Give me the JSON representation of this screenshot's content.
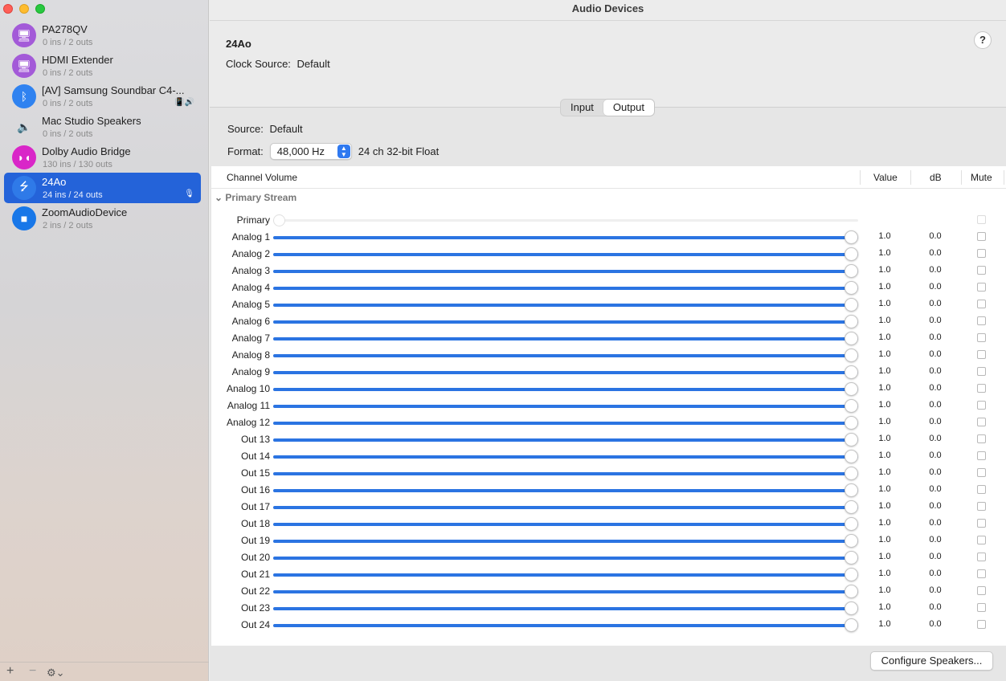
{
  "window": {
    "title": "Audio Devices"
  },
  "sidebar": {
    "devices": [
      {
        "name": "PA278QV",
        "io": "0 ins / 2 outs",
        "icon": "display-icon",
        "icon_color": "#a35ad8",
        "selected": false,
        "extra": ""
      },
      {
        "name": "HDMI Extender",
        "io": "0 ins / 2 outs",
        "icon": "display-icon",
        "icon_color": "#a35ad8",
        "selected": false,
        "extra": ""
      },
      {
        "name": "[AV] Samsung Soundbar C4-...",
        "io": "0 ins / 2 outs",
        "icon": "bluetooth-icon",
        "icon_color": "#2f82f0",
        "selected": false,
        "extra": "📳🔊"
      },
      {
        "name": "Mac Studio Speakers",
        "io": "0 ins / 2 outs",
        "icon": "speaker-icon",
        "icon_color": "#9a9a9a",
        "selected": false,
        "extra": ""
      },
      {
        "name": "Dolby Audio Bridge",
        "io": "130 ins / 130 outs",
        "icon": "dolby-icon",
        "icon_color": "#d926c8",
        "selected": false,
        "extra": ""
      },
      {
        "name": "24Ao",
        "io": "24 ins / 24 outs",
        "icon": "usb-icon",
        "icon_color": "#2f7ae8",
        "selected": true,
        "extra": "🎙"
      },
      {
        "name": "ZoomAudioDevice",
        "io": "2 ins / 2 outs",
        "icon": "video-camera-icon",
        "icon_color": "#1877e8",
        "selected": false,
        "extra": ""
      }
    ],
    "bottom": {
      "add": "+",
      "remove": "−",
      "gear": "⚙︎⌄"
    }
  },
  "header": {
    "device_title": "24Ao",
    "clock_label": "Clock Source:",
    "clock_value": "Default",
    "help": "?"
  },
  "tabs": {
    "input": "Input",
    "output": "Output",
    "active": "Output"
  },
  "settings": {
    "source_label": "Source:",
    "source_value": "Default",
    "format_label": "Format:",
    "format_value": "48,000 Hz",
    "format_detail": "24 ch 32-bit Float"
  },
  "table": {
    "columns": {
      "channel": "Channel Volume",
      "value": "Value",
      "db": "dB",
      "mute": "Mute"
    },
    "stream_label": "Primary Stream",
    "primary": {
      "label": "Primary",
      "level": 0.0
    },
    "channels": [
      {
        "label": "Analog 1",
        "level": 1.0,
        "value": "1.0",
        "db": "0.0",
        "muted": false
      },
      {
        "label": "Analog 2",
        "level": 1.0,
        "value": "1.0",
        "db": "0.0",
        "muted": false
      },
      {
        "label": "Analog 3",
        "level": 1.0,
        "value": "1.0",
        "db": "0.0",
        "muted": false
      },
      {
        "label": "Analog 4",
        "level": 1.0,
        "value": "1.0",
        "db": "0.0",
        "muted": false
      },
      {
        "label": "Analog 5",
        "level": 1.0,
        "value": "1.0",
        "db": "0.0",
        "muted": false
      },
      {
        "label": "Analog 6",
        "level": 1.0,
        "value": "1.0",
        "db": "0.0",
        "muted": false
      },
      {
        "label": "Analog 7",
        "level": 1.0,
        "value": "1.0",
        "db": "0.0",
        "muted": false
      },
      {
        "label": "Analog 8",
        "level": 1.0,
        "value": "1.0",
        "db": "0.0",
        "muted": false
      },
      {
        "label": "Analog 9",
        "level": 1.0,
        "value": "1.0",
        "db": "0.0",
        "muted": false
      },
      {
        "label": "Analog 10",
        "level": 1.0,
        "value": "1.0",
        "db": "0.0",
        "muted": false
      },
      {
        "label": "Analog 11",
        "level": 1.0,
        "value": "1.0",
        "db": "0.0",
        "muted": false
      },
      {
        "label": "Analog 12",
        "level": 1.0,
        "value": "1.0",
        "db": "0.0",
        "muted": false
      },
      {
        "label": "Out 13",
        "level": 1.0,
        "value": "1.0",
        "db": "0.0",
        "muted": false
      },
      {
        "label": "Out 14",
        "level": 1.0,
        "value": "1.0",
        "db": "0.0",
        "muted": false
      },
      {
        "label": "Out 15",
        "level": 1.0,
        "value": "1.0",
        "db": "0.0",
        "muted": false
      },
      {
        "label": "Out 16",
        "level": 1.0,
        "value": "1.0",
        "db": "0.0",
        "muted": false
      },
      {
        "label": "Out 17",
        "level": 1.0,
        "value": "1.0",
        "db": "0.0",
        "muted": false
      },
      {
        "label": "Out 18",
        "level": 1.0,
        "value": "1.0",
        "db": "0.0",
        "muted": false
      },
      {
        "label": "Out 19",
        "level": 1.0,
        "value": "1.0",
        "db": "0.0",
        "muted": false
      },
      {
        "label": "Out 20",
        "level": 1.0,
        "value": "1.0",
        "db": "0.0",
        "muted": false
      },
      {
        "label": "Out 21",
        "level": 1.0,
        "value": "1.0",
        "db": "0.0",
        "muted": false
      },
      {
        "label": "Out 22",
        "level": 1.0,
        "value": "1.0",
        "db": "0.0",
        "muted": false
      },
      {
        "label": "Out 23",
        "level": 1.0,
        "value": "1.0",
        "db": "0.0",
        "muted": false
      },
      {
        "label": "Out 24",
        "level": 1.0,
        "value": "1.0",
        "db": "0.0",
        "muted": false
      }
    ]
  },
  "footer": {
    "configure_button": "Configure Speakers..."
  },
  "colors": {
    "accent": "#2463d9",
    "slider_fill": "#2b74e2"
  }
}
